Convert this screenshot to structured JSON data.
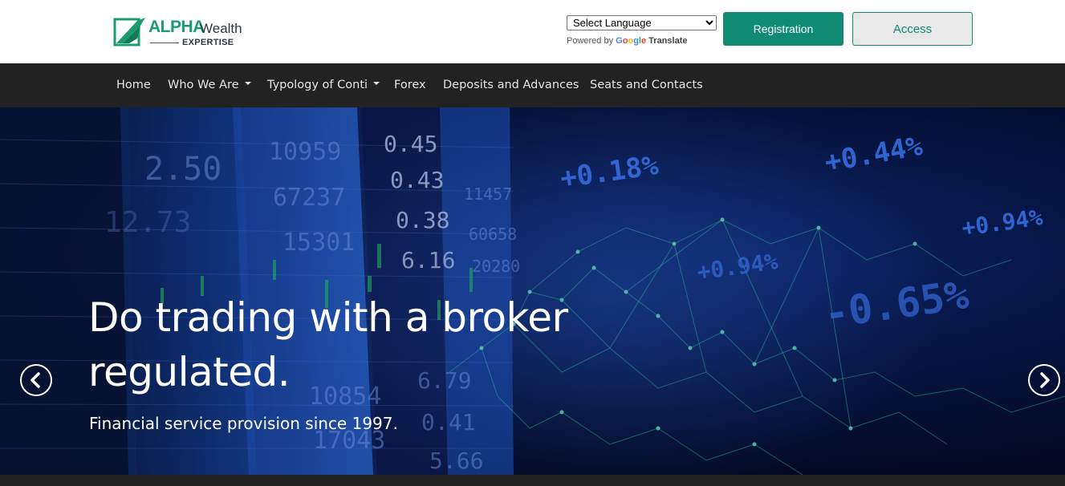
{
  "brand": {
    "name_primary": "ALPHA",
    "name_secondary": "Wealth",
    "tagline": "EXPERTISE",
    "colors": {
      "primary": "#0f8a73",
      "logo_green": "#1a9c6e",
      "nav_bg": "#222222"
    },
    "icon": "alpha-logo-mark-icon"
  },
  "translate": {
    "selected": "Select Language",
    "powered_by": "Powered by",
    "google": [
      "G",
      "o",
      "o",
      "g",
      "l",
      "e"
    ],
    "translate_label": "Translate"
  },
  "header_buttons": {
    "registration": "Registration",
    "access": "Access"
  },
  "nav": {
    "items": [
      {
        "label": "Home",
        "has_dropdown": false
      },
      {
        "label": "Who We Are",
        "has_dropdown": true
      },
      {
        "label": "Typology of Conti",
        "has_dropdown": true
      },
      {
        "label": "Forex",
        "has_dropdown": false
      },
      {
        "label": "Deposits and Advances",
        "has_dropdown": false
      },
      {
        "label": "Seats and Contacts",
        "has_dropdown": false
      }
    ]
  },
  "hero": {
    "title": "Do trading with a broker regulated.",
    "subtitle": "Financial service provision since 1997.",
    "prev_icon": "chevron-left-icon",
    "next_icon": "chevron-right-icon",
    "board_numbers": [
      "10959",
      "67237",
      "15301",
      "0.45",
      "0.43",
      "0.38",
      "6.16",
      "10854",
      "17043",
      "6.79",
      "0.41",
      "5.66",
      "2.50",
      "12.73",
      "11457",
      "60658",
      "20280"
    ],
    "percent_labels": [
      "+0.18%",
      "+0.44%",
      "+0.94%",
      "+0.94%",
      "-0.65%"
    ]
  }
}
